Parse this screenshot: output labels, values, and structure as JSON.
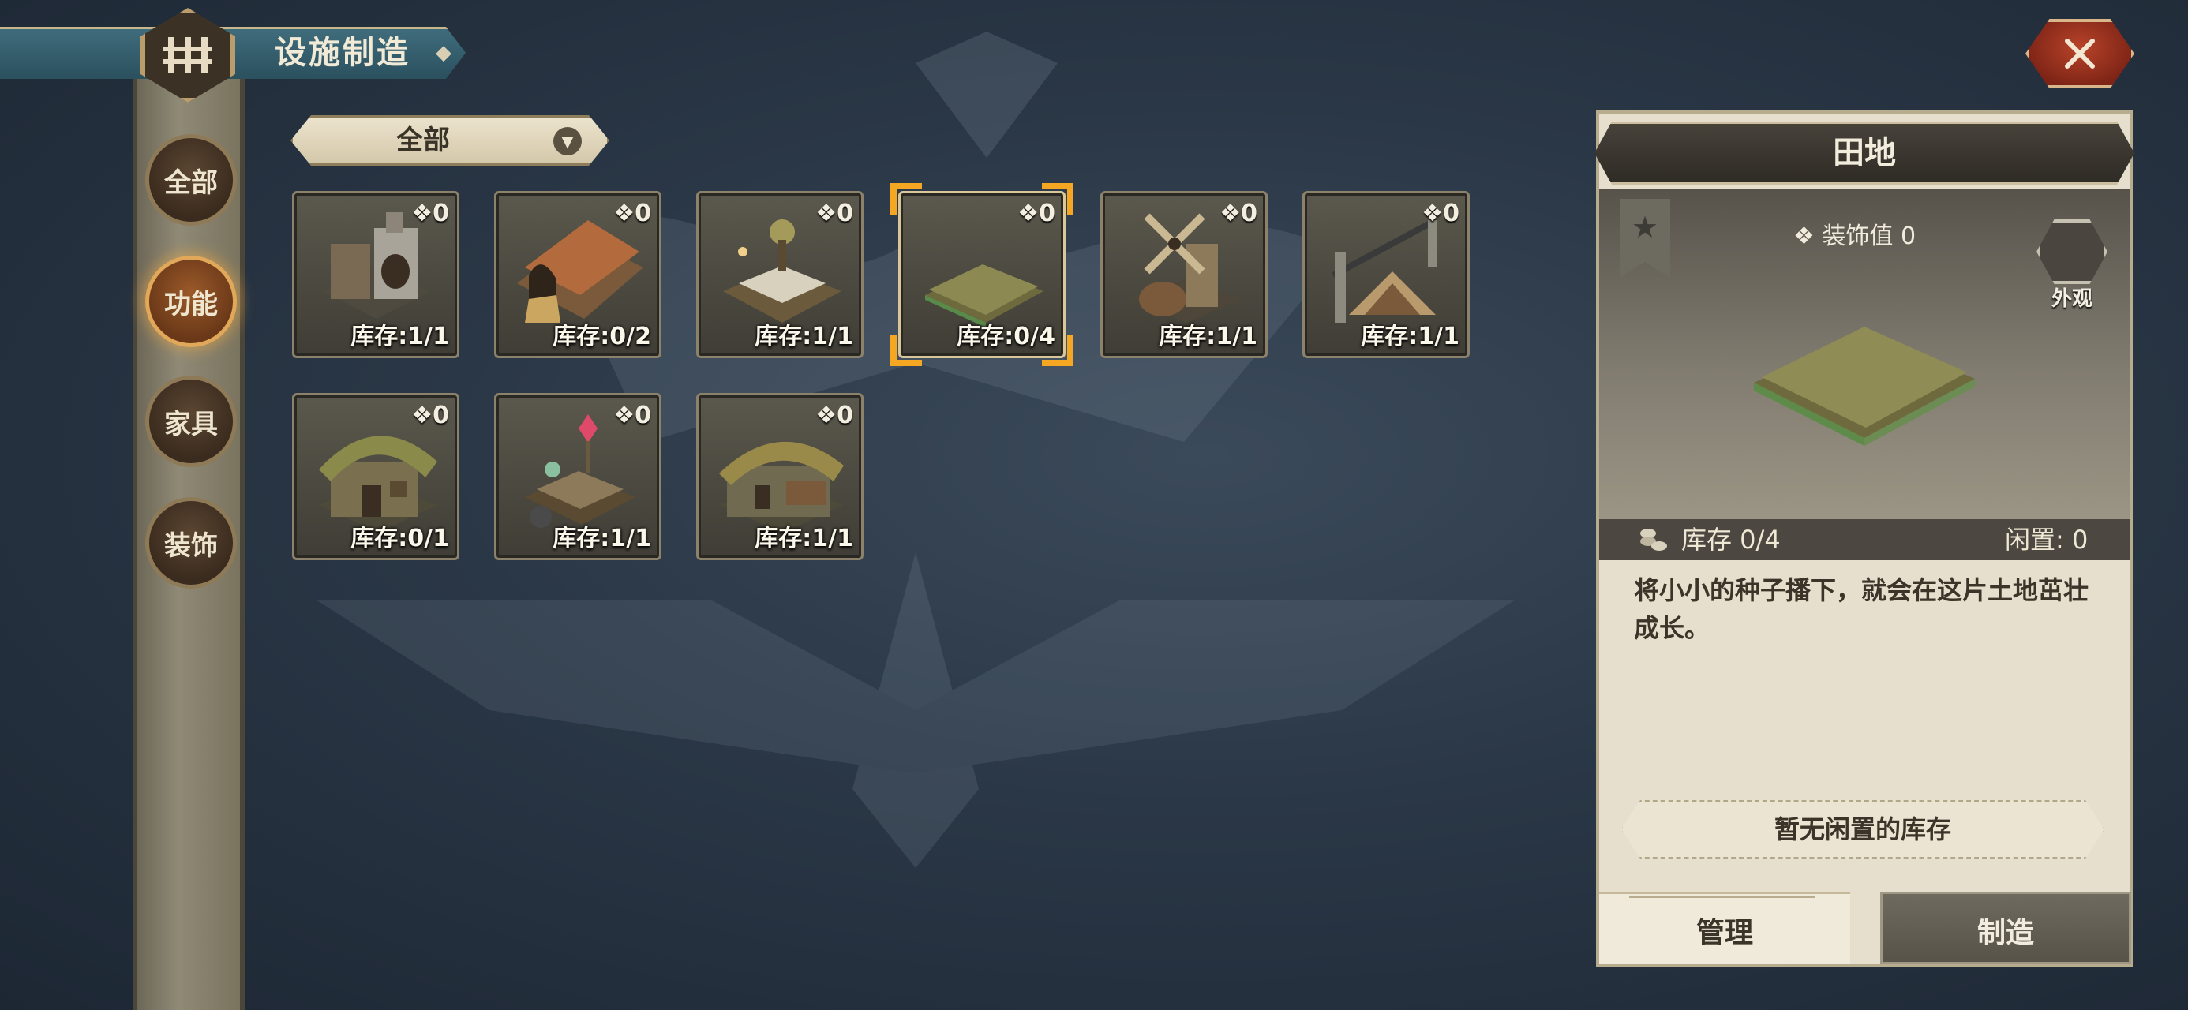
{
  "header": {
    "title": "设施制造"
  },
  "categories": [
    {
      "label": "全部",
      "active": false
    },
    {
      "label": "功能",
      "active": true
    },
    {
      "label": "家具",
      "active": false
    },
    {
      "label": "装饰",
      "active": false
    }
  ],
  "filter": {
    "selected": "全部"
  },
  "items": [
    {
      "name_icon": "workshop-furnace",
      "decor": "0",
      "stock": "库存:1/1"
    },
    {
      "name_icon": "barn-shed",
      "decor": "0",
      "stock": "库存:0/2"
    },
    {
      "name_icon": "crafting-table",
      "decor": "0",
      "stock": "库存:1/1"
    },
    {
      "name_icon": "farm-field",
      "decor": "0",
      "stock": "库存:0/4",
      "selected": true
    },
    {
      "name_icon": "windmill-mill",
      "decor": "0",
      "stock": "库存:1/1"
    },
    {
      "name_icon": "campfire-tent",
      "decor": "0",
      "stock": "库存:1/1"
    },
    {
      "name_icon": "thatched-house",
      "decor": "0",
      "stock": "库存:0/1"
    },
    {
      "name_icon": "alchemy-table",
      "decor": "0",
      "stock": "库存:1/1"
    },
    {
      "name_icon": "thatched-cottage",
      "decor": "0",
      "stock": "库存:1/1"
    }
  ],
  "detail": {
    "title": "田地",
    "decor_line": "装饰值 0",
    "skin_label": "外观",
    "stock": "库存 0/4",
    "idle": "闲置: 0",
    "description": "将小小的种子播下，就会在这片土地茁壮成长。",
    "no_idle": "暂无闲置的库存",
    "tabs": {
      "manage": "管理",
      "make": "制造"
    }
  },
  "colors": {
    "accent": "#f5a623",
    "active_category": "#9b5a2a",
    "close_button": "#b8432a"
  }
}
